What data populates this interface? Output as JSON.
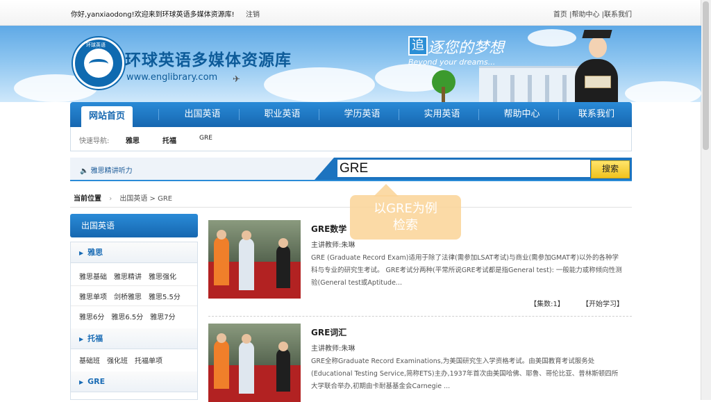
{
  "topbar": {
    "welcome": "你好,yanxiaodong!欢迎来到环球英语多媒体资源库!",
    "logout": "注销",
    "links": "首页 |帮助中心 |联系我们"
  },
  "banner": {
    "title": "环球英语多媒体资源库",
    "url": "www.englibrary.com",
    "logo_text": "环球英语",
    "slogan_box": "追",
    "slogan": "逐您的梦想",
    "slogan_en": "Beyond your dreams..."
  },
  "nav": {
    "items": [
      "网站首页",
      "出国英语",
      "职业英语",
      "学历英语",
      "实用英语",
      "帮助中心",
      "联系我们"
    ]
  },
  "quicknav": {
    "label": "快速导航:",
    "links": [
      "雅思",
      "托福",
      "GRE"
    ]
  },
  "search": {
    "left_label": "雅思精讲听力",
    "value": "GRE",
    "button": "搜索"
  },
  "breadcrumb": {
    "label": "当前位置",
    "path": "出国英语 > GRE"
  },
  "sidebar": {
    "header": "出国英语",
    "categories": [
      {
        "name": "雅思",
        "rows": [
          [
            "雅思基础",
            "雅思精讲",
            "雅思强化"
          ],
          [
            "雅思单项",
            "剑桥雅思",
            "雅思5.5分"
          ],
          [
            "雅思6分",
            "雅思6.5分",
            "雅思7分"
          ]
        ]
      },
      {
        "name": "托福",
        "rows": [
          [
            "基础班",
            "强化班",
            "托福单项"
          ]
        ]
      },
      {
        "name": "GRE",
        "rows": []
      }
    ]
  },
  "courses": [
    {
      "title": "GRE数学",
      "teacher": "主讲教师:朱琳",
      "desc": "GRE (Graduate Record Exam)适用于除了法律(需参加LSAT考试)与商业(需参加GMAT考)以外的各种学科与专业的研究生考试。 GRE考试分两种(平常所说GRE考试都是指General test): 一般能力或称倾向性测验(General test或Aptitude...",
      "count": "【集数:1】",
      "start": "【开始学习】"
    },
    {
      "title": "GRE词汇",
      "teacher": "主讲教师:朱琳",
      "desc": "GRE全称Graduate Record Examinations,为美国研究生入学资格考试。由美国教育考试服务处(Educational Testing Service,简称ETS)主办,1937年首次由美国哈佛、耶鲁、哥伦比亚、普林斯顿四所大学联合举办,初期由卡耐基基金会Carnegie ...",
      "count": "",
      "start": ""
    }
  ],
  "callout": {
    "line1": "以GRE为例",
    "line2": "检索"
  }
}
